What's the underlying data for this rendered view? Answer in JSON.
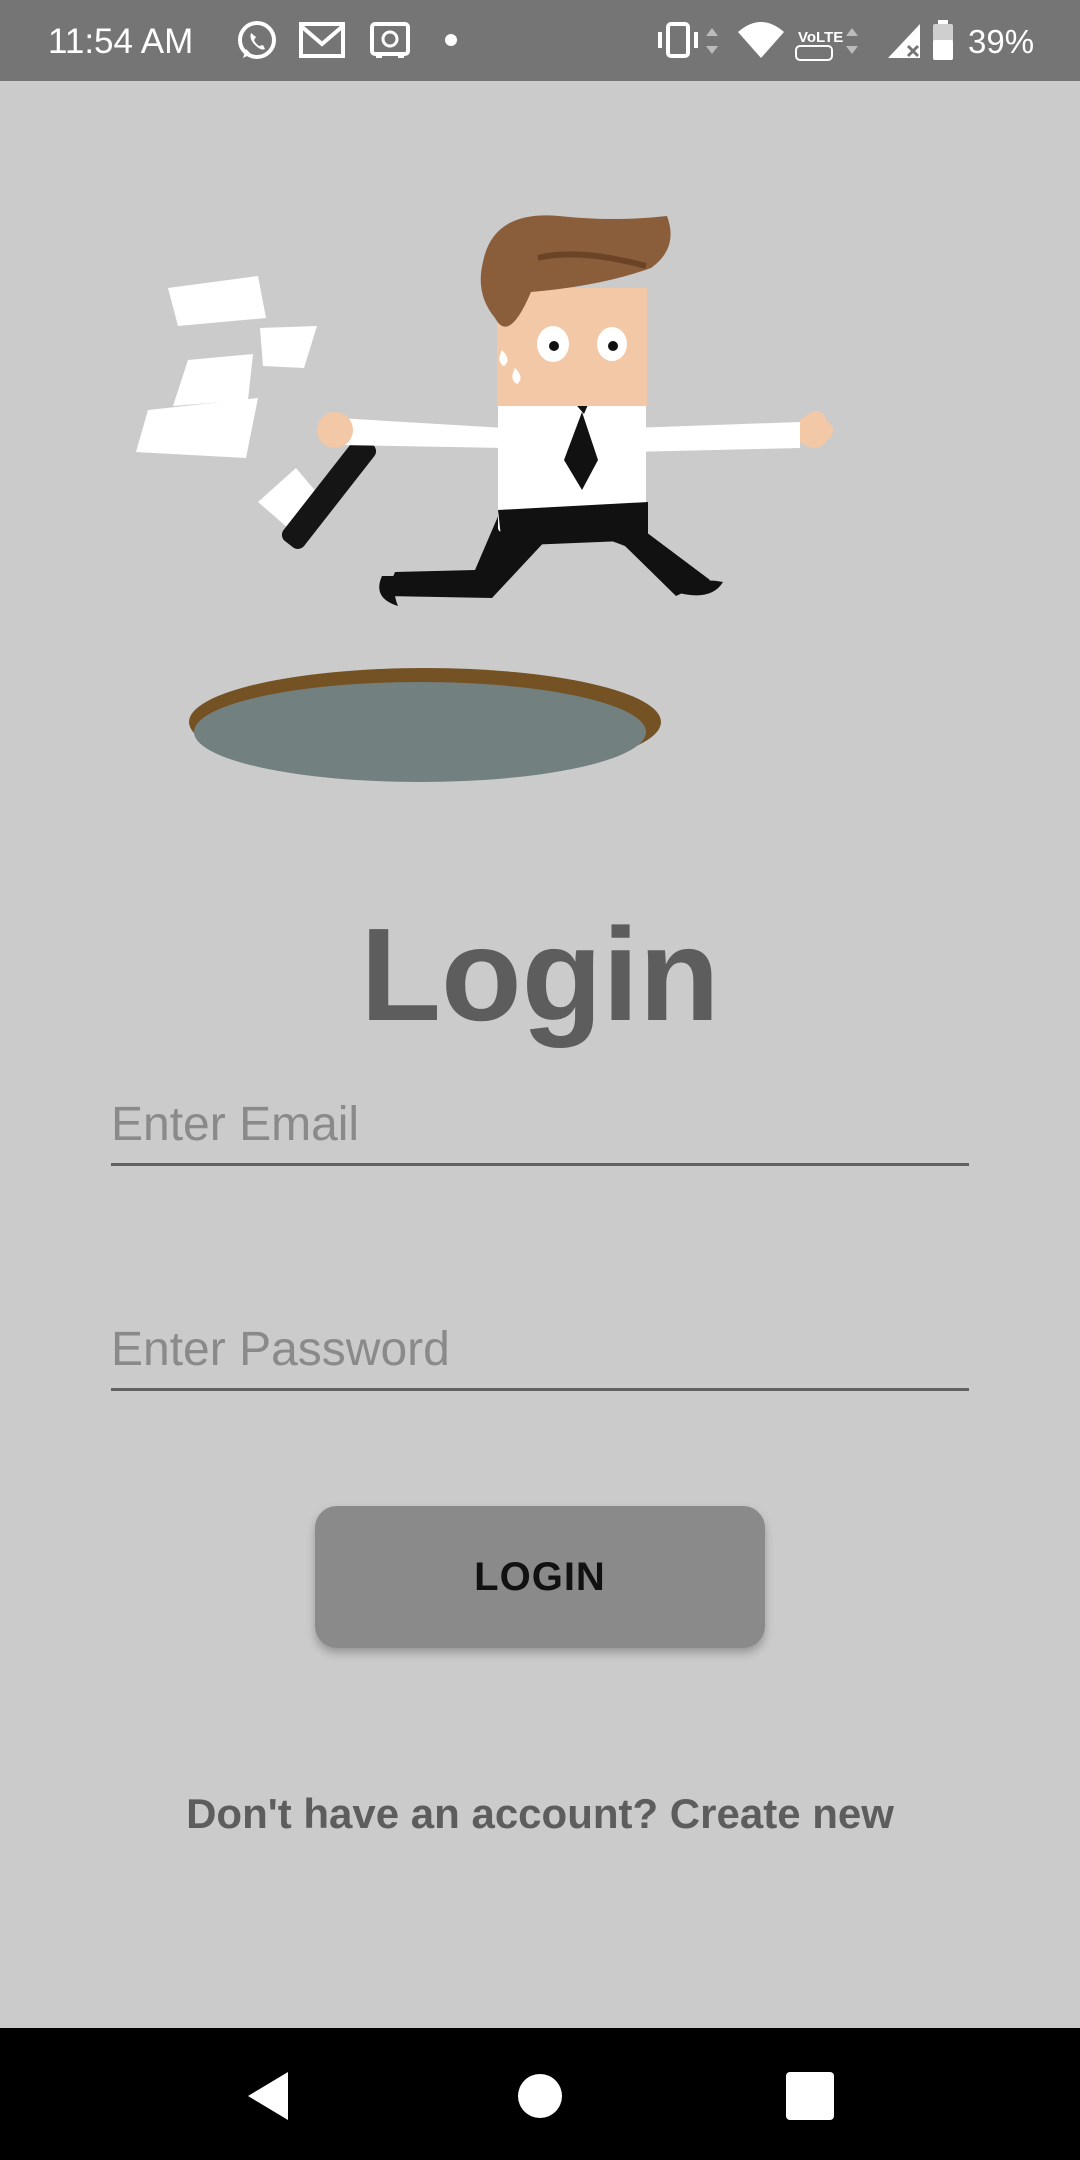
{
  "status_bar": {
    "time": "11:54 AM",
    "notification_icons": [
      "whatsapp-icon",
      "gmail-icon",
      "safe-icon",
      "dot-icon"
    ],
    "system_icons": [
      "vibrate-icon",
      "wifi-icon",
      "volte-icon",
      "signal-icon",
      "battery-icon"
    ],
    "volte_label": "VoLTE",
    "battery_percent": "39%"
  },
  "illustration": "running-businessman-illustration",
  "login": {
    "title": "Login",
    "email_placeholder": "Enter Email",
    "email_value": "",
    "password_placeholder": "Enter Password",
    "password_value": "",
    "button_label": "LOGIN",
    "signup_text": "Don't have an account? Create new"
  },
  "nav_bar": {
    "buttons": [
      "back-icon",
      "home-icon",
      "recents-icon"
    ]
  },
  "colors": {
    "background": "#cbcbcb",
    "status_bar": "#757575",
    "title_text": "#5d5d5d",
    "button": "#8a8a8a",
    "nav_bar": "#000000"
  }
}
